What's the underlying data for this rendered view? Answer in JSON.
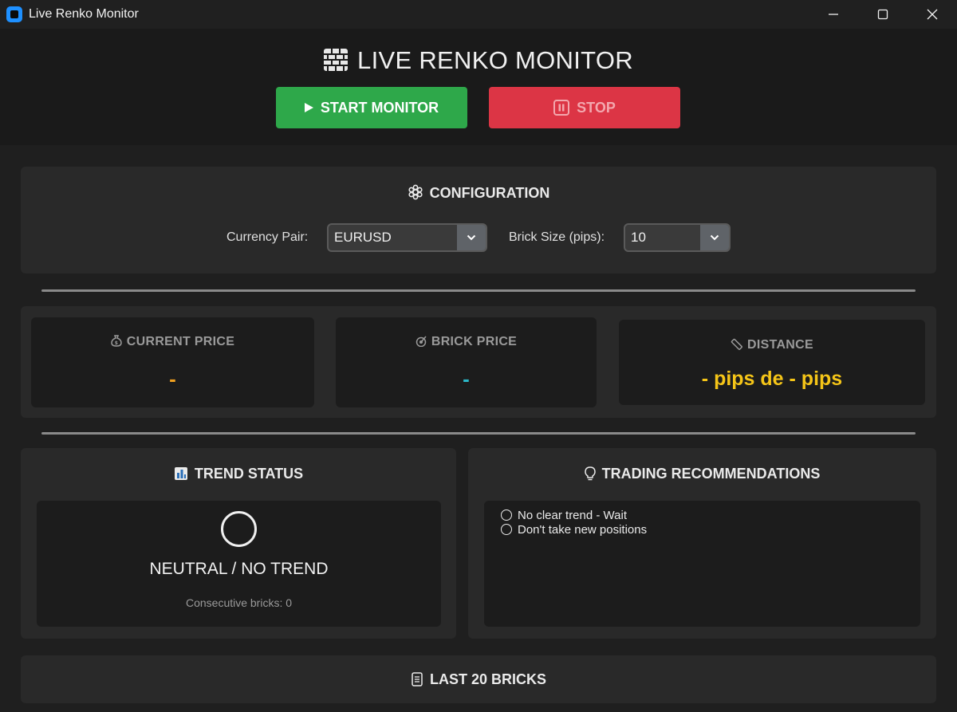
{
  "window": {
    "title": "Live Renko Monitor"
  },
  "header": {
    "title": "LIVE RENKO MONITOR",
    "start_label": "START MONITOR",
    "stop_label": "STOP"
  },
  "config": {
    "title": "CONFIGURATION",
    "currency_label": "Currency Pair:",
    "currency_value": "EURUSD",
    "brick_label": "Brick Size (pips):",
    "brick_value": "10"
  },
  "stats": {
    "current_price": {
      "label": "CURRENT PRICE",
      "value": "-",
      "color": "#f0a020",
      "icon": "money-bag-icon"
    },
    "brick_price": {
      "label": "BRICK PRICE",
      "value": "-",
      "color": "#2bb8c8",
      "icon": "target-icon"
    },
    "distance": {
      "label": "DISTANCE",
      "value": "- pips de - pips",
      "color": "#f5c518",
      "icon": "ruler-icon"
    }
  },
  "trend": {
    "title": "TREND STATUS",
    "status": "NEUTRAL / NO TREND",
    "consecutive": "Consecutive bricks: 0"
  },
  "recommendations": {
    "title": "TRADING RECOMMENDATIONS",
    "items": [
      "No clear trend - Wait",
      "Don't take new positions"
    ]
  },
  "last_bricks": {
    "title": "LAST 20 BRICKS"
  },
  "colors": {
    "start": "#2ea84a",
    "stop": "#dc3545",
    "background": "#1f1f1f",
    "panel": "#292929"
  }
}
